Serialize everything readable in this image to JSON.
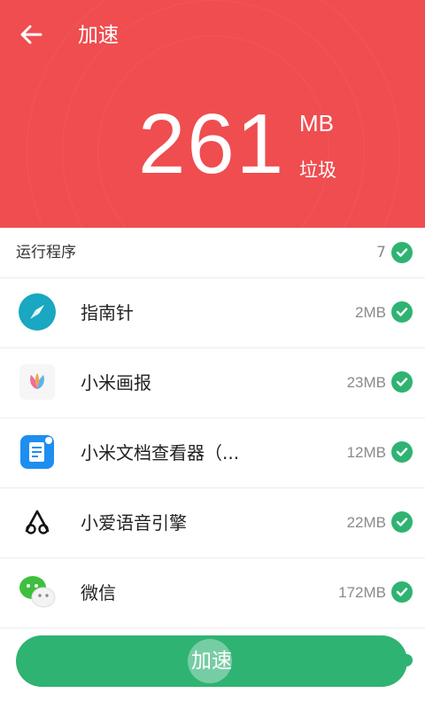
{
  "header": {
    "title": "加速",
    "junk_amount": "261",
    "junk_unit": "MB",
    "junk_label": "垃圾",
    "background_color": "#ef4d50"
  },
  "section": {
    "label": "运行程序",
    "count": "7"
  },
  "apps": [
    {
      "name": "指南针",
      "size": "2MB",
      "icon": "compass-icon"
    },
    {
      "name": "小米画报",
      "size": "23MB",
      "icon": "mi-wallpaper-icon"
    },
    {
      "name": "小米文档查看器（...",
      "size": "12MB",
      "icon": "document-viewer-icon"
    },
    {
      "name": "小爱语音引擎",
      "size": "22MB",
      "icon": "xiaoai-voice-icon"
    },
    {
      "name": "微信",
      "size": "172MB",
      "icon": "wechat-icon"
    }
  ],
  "action": {
    "label": "加速",
    "color": "#2fb372"
  }
}
